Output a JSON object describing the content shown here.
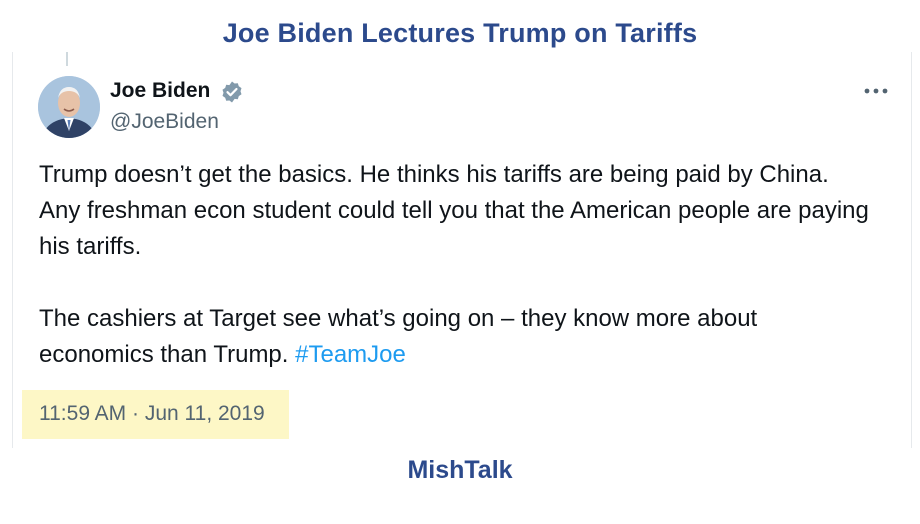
{
  "page": {
    "title": "Joe Biden Lectures Trump on Tariffs",
    "footer": "MishTalk",
    "title_color": "#2c4a8c"
  },
  "tweet": {
    "author": {
      "name": "Joe Biden",
      "handle": "@JoeBiden",
      "verified_icon": "verified-badge-icon",
      "avatar_icon": "avatar"
    },
    "more_icon": "more-dots-icon",
    "paragraphs": [
      "Trump doesn’t get the basics. He thinks his tariffs are being paid by China. Any freshman econ student could tell you that the American people are paying his tariffs.",
      "The cashiers at Target see what’s going on – they know more about economics than Trump."
    ],
    "hashtag": "#TeamJoe",
    "timestamp": "11:59 AM · Jun 11, 2019",
    "colors": {
      "text": "#0f1419",
      "muted": "#536471",
      "link": "#1d9bf0",
      "highlight": "#fdf7c6"
    }
  }
}
